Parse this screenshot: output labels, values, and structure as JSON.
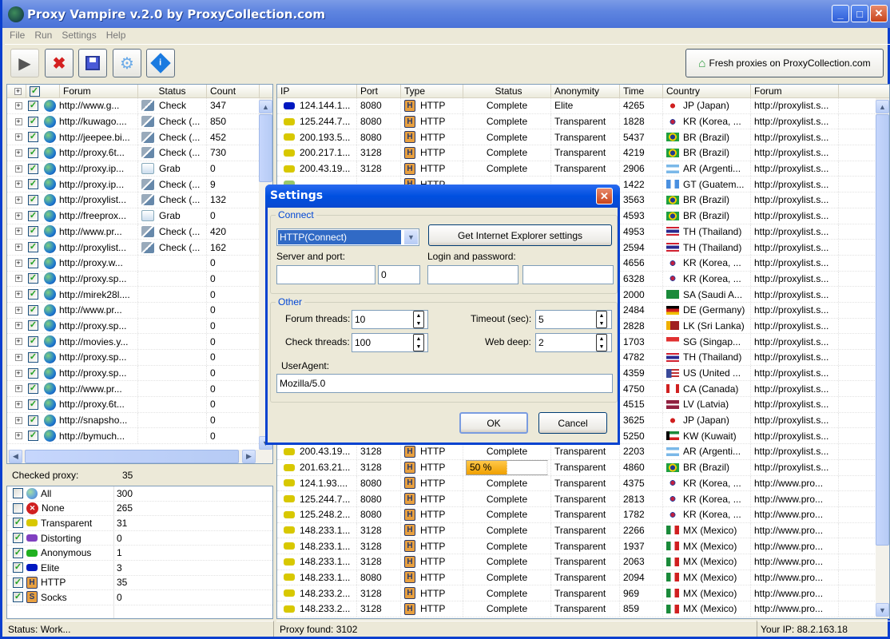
{
  "window": {
    "title": "Proxy Vampire v.2.0 by ProxyCollection.com"
  },
  "menu": [
    "File",
    "Run",
    "Settings",
    "Help"
  ],
  "toolbar": {
    "buttons": [
      {
        "name": "start",
        "icon": "play-icon"
      },
      {
        "name": "stop",
        "icon": "stop-x-icon"
      },
      {
        "name": "save",
        "icon": "floppy-disk-icon"
      },
      {
        "name": "settings",
        "icon": "gear-icon"
      },
      {
        "name": "about",
        "icon": "info-icon"
      }
    ],
    "fresh_label": "Fresh proxies on ProxyCollection.com"
  },
  "forums": {
    "columns": [
      "Forum",
      "Status",
      "Count"
    ],
    "rows": [
      {
        "url": "http://www.g...",
        "status": "Check",
        "status_icon": "check",
        "count": "347"
      },
      {
        "url": "http://kuwago....",
        "status": "Check (...",
        "status_icon": "check",
        "count": "850"
      },
      {
        "url": "http://jeepee.bi...",
        "status": "Check (...",
        "status_icon": "check",
        "count": "452"
      },
      {
        "url": "http://proxy.6t...",
        "status": "Check (...",
        "status_icon": "check",
        "count": "730"
      },
      {
        "url": "http://proxy.ip...",
        "status": "Grab",
        "status_icon": "grab",
        "count": "0"
      },
      {
        "url": "http://proxy.ip...",
        "status": "Check (...",
        "status_icon": "check",
        "count": "9"
      },
      {
        "url": "http://proxylist...",
        "status": "Check (...",
        "status_icon": "check",
        "count": "132"
      },
      {
        "url": "http://freeprox...",
        "status": "Grab",
        "status_icon": "grab",
        "count": "0"
      },
      {
        "url": "http://www.pr...",
        "status": "Check (...",
        "status_icon": "check",
        "count": "420"
      },
      {
        "url": "http://proxylist...",
        "status": "Check (...",
        "status_icon": "check",
        "count": "162"
      },
      {
        "url": "http://proxy.w...",
        "status": "",
        "status_icon": "",
        "count": "0"
      },
      {
        "url": "http://proxy.sp...",
        "status": "",
        "status_icon": "",
        "count": "0"
      },
      {
        "url": "http://mirek28l....",
        "status": "",
        "status_icon": "",
        "count": "0"
      },
      {
        "url": "http://www.pr...",
        "status": "",
        "status_icon": "",
        "count": "0"
      },
      {
        "url": "http://proxy.sp...",
        "status": "",
        "status_icon": "",
        "count": "0"
      },
      {
        "url": "http://movies.y...",
        "status": "",
        "status_icon": "",
        "count": "0"
      },
      {
        "url": "http://proxy.sp...",
        "status": "",
        "status_icon": "",
        "count": "0"
      },
      {
        "url": "http://proxy.sp...",
        "status": "",
        "status_icon": "",
        "count": "0"
      },
      {
        "url": "http://www.pr...",
        "status": "",
        "status_icon": "",
        "count": "0"
      },
      {
        "url": "http://proxy.6t...",
        "status": "",
        "status_icon": "",
        "count": "0"
      },
      {
        "url": "http://snapsho...",
        "status": "",
        "status_icon": "",
        "count": "0"
      },
      {
        "url": "http://bymuch...",
        "status": "",
        "status_icon": "",
        "count": "0"
      }
    ]
  },
  "checked": {
    "label": "Checked proxy:",
    "value": "35",
    "filters": [
      {
        "label": "All",
        "count": "300",
        "checked": false,
        "icon": "globe"
      },
      {
        "label": "None",
        "count": "265",
        "checked": false,
        "icon": "none"
      },
      {
        "label": "Transparent",
        "count": "31",
        "checked": true,
        "icon": "box",
        "color": "#d8c800"
      },
      {
        "label": "Distorting",
        "count": "0",
        "checked": true,
        "icon": "box",
        "color": "#8040c0"
      },
      {
        "label": "Anonymous",
        "count": "1",
        "checked": true,
        "icon": "box",
        "color": "#20b020"
      },
      {
        "label": "Elite",
        "count": "3",
        "checked": true,
        "icon": "box",
        "color": "#0018c0"
      },
      {
        "label": "HTTP",
        "count": "35",
        "checked": true,
        "icon": "H"
      },
      {
        "label": "Socks",
        "count": "0",
        "checked": true,
        "icon": "S"
      }
    ]
  },
  "proxies": {
    "columns": [
      "IP",
      "Port",
      "Type",
      "Status",
      "Anonymity",
      "Time",
      "Country",
      "Forum"
    ],
    "rows": [
      {
        "ip": "124.144.1...",
        "port": "8080",
        "type": "HTTP",
        "status": "Complete",
        "anon": "Elite",
        "time": "4265",
        "country": "JP (Japan)",
        "flag": "jp",
        "forum": "http://proxylist.s..."
      },
      {
        "ip": "125.244.7...",
        "port": "8080",
        "type": "HTTP",
        "status": "Complete",
        "anon": "Transparent",
        "time": "1828",
        "country": "KR (Korea, ...",
        "flag": "kr",
        "forum": "http://proxylist.s..."
      },
      {
        "ip": "200.193.5...",
        "port": "8080",
        "type": "HTTP",
        "status": "Complete",
        "anon": "Transparent",
        "time": "5437",
        "country": "BR (Brazil)",
        "flag": "br",
        "forum": "http://proxylist.s..."
      },
      {
        "ip": "200.217.1...",
        "port": "3128",
        "type": "HTTP",
        "status": "Complete",
        "anon": "Transparent",
        "time": "4219",
        "country": "BR (Brazil)",
        "flag": "br",
        "forum": "http://proxylist.s..."
      },
      {
        "ip": "200.43.19...",
        "port": "3128",
        "type": "HTTP",
        "status": "Complete",
        "anon": "Transparent",
        "time": "2906",
        "country": "AR (Argenti...",
        "flag": "ar",
        "forum": "http://proxylist.s..."
      },
      {
        "ip": "",
        "port": "",
        "type": "HTTP",
        "status": "",
        "anon": "",
        "time": "1422",
        "country": "GT (Guatem...",
        "flag": "gt",
        "forum": "http://proxylist.s..."
      },
      {
        "ip": "",
        "port": "",
        "type": "",
        "status": "",
        "anon": "",
        "time": "3563",
        "country": "BR (Brazil)",
        "flag": "br",
        "forum": "http://proxylist.s..."
      },
      {
        "ip": "",
        "port": "",
        "type": "",
        "status": "",
        "anon": "",
        "time": "4593",
        "country": "BR (Brazil)",
        "flag": "br",
        "forum": "http://proxylist.s..."
      },
      {
        "ip": "",
        "port": "",
        "type": "",
        "status": "",
        "anon": "",
        "time": "4953",
        "country": "TH (Thailand)",
        "flag": "th",
        "forum": "http://proxylist.s..."
      },
      {
        "ip": "",
        "port": "",
        "type": "",
        "status": "",
        "anon": "",
        "time": "2594",
        "country": "TH (Thailand)",
        "flag": "th",
        "forum": "http://proxylist.s..."
      },
      {
        "ip": "",
        "port": "",
        "type": "",
        "status": "",
        "anon": "",
        "time": "4656",
        "country": "KR (Korea, ...",
        "flag": "kr",
        "forum": "http://proxylist.s..."
      },
      {
        "ip": "",
        "port": "",
        "type": "",
        "status": "",
        "anon": "",
        "time": "6328",
        "country": "KR (Korea, ...",
        "flag": "kr",
        "forum": "http://proxylist.s..."
      },
      {
        "ip": "",
        "port": "",
        "type": "",
        "status": "",
        "anon": "",
        "time": "2000",
        "country": "SA (Saudi A...",
        "flag": "sa",
        "forum": "http://proxylist.s..."
      },
      {
        "ip": "",
        "port": "",
        "type": "",
        "status": "",
        "anon": "",
        "time": "2484",
        "country": "DE (Germany)",
        "flag": "de",
        "forum": "http://proxylist.s..."
      },
      {
        "ip": "",
        "port": "",
        "type": "",
        "status": "",
        "anon": "",
        "time": "2828",
        "country": "LK (Sri Lanka)",
        "flag": "lk",
        "forum": "http://proxylist.s..."
      },
      {
        "ip": "",
        "port": "",
        "type": "",
        "status": "",
        "anon": "",
        "time": "1703",
        "country": "SG (Singap...",
        "flag": "sg",
        "forum": "http://proxylist.s..."
      },
      {
        "ip": "",
        "port": "",
        "type": "",
        "status": "",
        "anon": "",
        "time": "4782",
        "country": "TH (Thailand)",
        "flag": "th",
        "forum": "http://proxylist.s..."
      },
      {
        "ip": "",
        "port": "",
        "type": "",
        "status": "",
        "anon": "",
        "time": "4359",
        "country": "US (United ...",
        "flag": "us",
        "forum": "http://proxylist.s..."
      },
      {
        "ip": "",
        "port": "",
        "type": "",
        "status": "",
        "anon": "",
        "time": "4750",
        "country": "CA (Canada)",
        "flag": "ca",
        "forum": "http://proxylist.s..."
      },
      {
        "ip": "",
        "port": "",
        "type": "",
        "status": "",
        "anon": "",
        "time": "4515",
        "country": "LV (Latvia)",
        "flag": "lv",
        "forum": "http://proxylist.s..."
      },
      {
        "ip": "",
        "port": "",
        "type": "",
        "status": "",
        "anon": "",
        "time": "3625",
        "country": "JP (Japan)",
        "flag": "jp",
        "forum": "http://proxylist.s..."
      },
      {
        "ip": "",
        "port": "",
        "type": "",
        "status": "",
        "anon": "",
        "time": "5250",
        "country": "KW (Kuwait)",
        "flag": "kw",
        "forum": "http://proxylist.s..."
      },
      {
        "ip": "200.43.19...",
        "port": "3128",
        "type": "HTTP",
        "status": "Complete",
        "anon": "Transparent",
        "time": "2203",
        "country": "AR (Argenti...",
        "flag": "ar",
        "forum": "http://proxylist.s..."
      },
      {
        "ip": "201.63.21...",
        "port": "3128",
        "type": "HTTP",
        "status": "50 %",
        "progress": 50,
        "anon": "Transparent",
        "time": "4860",
        "country": "BR (Brazil)",
        "flag": "br",
        "forum": "http://proxylist.s..."
      },
      {
        "ip": "124.1.93....",
        "port": "8080",
        "type": "HTTP",
        "status": "Complete",
        "anon": "Transparent",
        "time": "4375",
        "country": "KR (Korea, ...",
        "flag": "kr",
        "forum": "http://www.pro..."
      },
      {
        "ip": "125.244.7...",
        "port": "8080",
        "type": "HTTP",
        "status": "Complete",
        "anon": "Transparent",
        "time": "2813",
        "country": "KR (Korea, ...",
        "flag": "kr",
        "forum": "http://www.pro..."
      },
      {
        "ip": "125.248.2...",
        "port": "8080",
        "type": "HTTP",
        "status": "Complete",
        "anon": "Transparent",
        "time": "1782",
        "country": "KR (Korea, ...",
        "flag": "kr",
        "forum": "http://www.pro..."
      },
      {
        "ip": "148.233.1...",
        "port": "3128",
        "type": "HTTP",
        "status": "Complete",
        "anon": "Transparent",
        "time": "2266",
        "country": "MX (Mexico)",
        "flag": "mx",
        "forum": "http://www.pro..."
      },
      {
        "ip": "148.233.1...",
        "port": "3128",
        "type": "HTTP",
        "status": "Complete",
        "anon": "Transparent",
        "time": "1937",
        "country": "MX (Mexico)",
        "flag": "mx",
        "forum": "http://www.pro..."
      },
      {
        "ip": "148.233.1...",
        "port": "3128",
        "type": "HTTP",
        "status": "Complete",
        "anon": "Transparent",
        "time": "2063",
        "country": "MX (Mexico)",
        "flag": "mx",
        "forum": "http://www.pro..."
      },
      {
        "ip": "148.233.1...",
        "port": "8080",
        "type": "HTTP",
        "status": "Complete",
        "anon": "Transparent",
        "time": "2094",
        "country": "MX (Mexico)",
        "flag": "mx",
        "forum": "http://www.pro..."
      },
      {
        "ip": "148.233.2...",
        "port": "3128",
        "type": "HTTP",
        "status": "Complete",
        "anon": "Transparent",
        "time": "969",
        "country": "MX (Mexico)",
        "flag": "mx",
        "forum": "http://www.pro..."
      },
      {
        "ip": "148.233.2...",
        "port": "3128",
        "type": "HTTP",
        "status": "Complete",
        "anon": "Transparent",
        "time": "859",
        "country": "MX (Mexico)",
        "flag": "mx",
        "forum": "http://www.pro..."
      }
    ]
  },
  "status": {
    "left": "Status: Work...",
    "middle": "Proxy found: 3102",
    "right": "Your IP: 88.2.163.18"
  },
  "settings_dialog": {
    "title": "Settings",
    "connect_group": "Connect",
    "proxy_type": "HTTP(Connect)",
    "ie_button": "Get Internet Explorer settings",
    "server_label": "Server and port:",
    "server_value": "",
    "port_value": "0",
    "login_label": "Login and password:",
    "login_value": "",
    "password_value": "",
    "other_group": "Other",
    "forum_threads_label": "Forum threads:",
    "forum_threads": "10",
    "check_threads_label": "Check threads:",
    "check_threads": "100",
    "timeout_label": "Timeout (sec):",
    "timeout": "5",
    "web_deep_label": "Web deep:",
    "web_deep": "2",
    "useragent_label": "UserAgent:",
    "useragent": "Mozilla/5.0",
    "ok": "OK",
    "cancel": "Cancel"
  },
  "colors": {
    "transparent": "#d8c800",
    "elite": "#0018c0",
    "titlebar": "#0050e0",
    "progress": "#f0a000"
  }
}
